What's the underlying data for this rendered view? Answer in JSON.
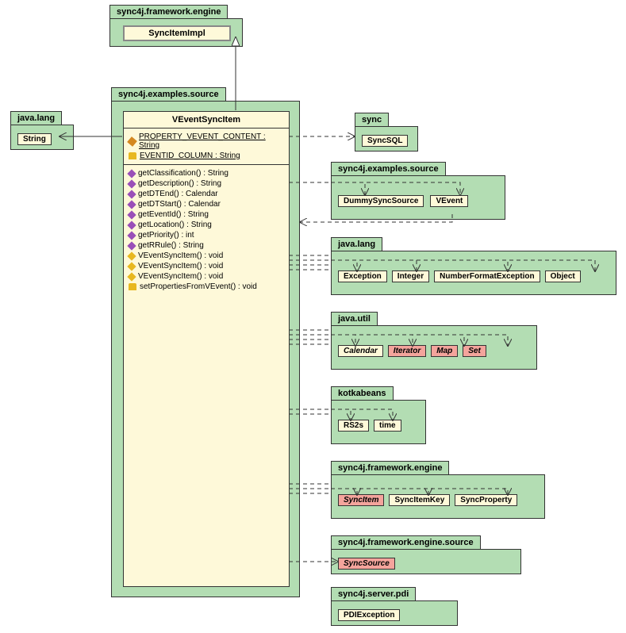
{
  "packages": {
    "engine_top": {
      "name": "sync4j.framework.engine",
      "classes": [
        "SyncItemImpl"
      ]
    },
    "java_lang_left": {
      "name": "java.lang",
      "classes": [
        "String"
      ]
    },
    "main": {
      "name": "sync4j.examples.source",
      "main_class": "VEventSyncItem"
    },
    "sync": {
      "name": "sync",
      "classes": [
        "SyncSQL"
      ]
    },
    "examples_source": {
      "name": "sync4j.examples.source",
      "classes": [
        "DummySyncSource",
        "VEvent"
      ]
    },
    "java_lang": {
      "name": "java.lang",
      "classes": [
        "Exception",
        "Integer",
        "NumberFormatException",
        "Object"
      ]
    },
    "java_util": {
      "name": "java.util",
      "classes": [
        "Calendar",
        "Iterator",
        "Map",
        "Set"
      ]
    },
    "kotkabeans": {
      "name": "kotkabeans",
      "classes": [
        "RS2s",
        "time"
      ]
    },
    "engine": {
      "name": "sync4j.framework.engine",
      "classes": [
        "SyncItem",
        "SyncItemKey",
        "SyncProperty"
      ]
    },
    "engine_source": {
      "name": "sync4j.framework.engine.source",
      "classes": [
        "SyncSource"
      ]
    },
    "server_pdi": {
      "name": "sync4j.server.pdi",
      "classes": [
        "PDIException"
      ]
    }
  },
  "main_class": {
    "name": "VEventSyncItem",
    "attributes": [
      {
        "name": "PROPERTY_VEVENT_CONTENT : String",
        "icon": "pencil"
      },
      {
        "name": "EVENTID_COLUMN : String",
        "icon": "lock"
      }
    ],
    "methods": [
      {
        "name": "getClassification() : String",
        "icon": "public"
      },
      {
        "name": "getDescription() : String",
        "icon": "public"
      },
      {
        "name": "getDTEnd() : Calendar",
        "icon": "public"
      },
      {
        "name": "getDTStart() : Calendar",
        "icon": "public"
      },
      {
        "name": "getEventId() : String",
        "icon": "public"
      },
      {
        "name": "getLocation() : String",
        "icon": "public"
      },
      {
        "name": "getPriority() : int",
        "icon": "public"
      },
      {
        "name": "getRRule() : String",
        "icon": "public"
      },
      {
        "name": "VEventSyncItem() : void",
        "icon": "constructor"
      },
      {
        "name": "VEventSyncItem() : void",
        "icon": "constructor"
      },
      {
        "name": "VEventSyncItem() : void",
        "icon": "constructor"
      },
      {
        "name": "setPropertiesFromVEvent() : void",
        "icon": "lock"
      }
    ]
  }
}
